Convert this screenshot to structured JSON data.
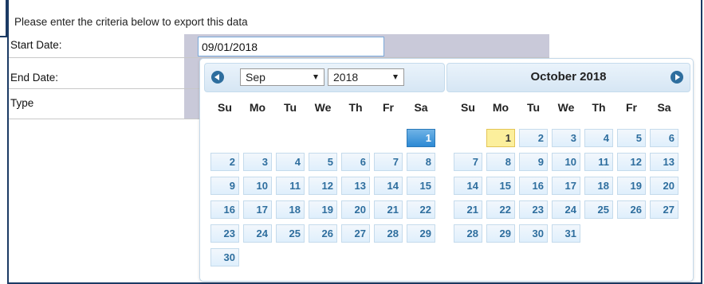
{
  "form": {
    "intro": "Please enter the criteria below to export this data",
    "start_label": "Start Date:",
    "end_label": "End Date:",
    "type_label": "Type",
    "start_value": "09/01/2018"
  },
  "calendar": {
    "weekdays": [
      "Su",
      "Mo",
      "Tu",
      "We",
      "Th",
      "Fr",
      "Sa"
    ],
    "left": {
      "month_select": "Sep",
      "year_select": "2018",
      "first_weekday": 6,
      "days_in_month": 30,
      "selected_day": 1
    },
    "right": {
      "title": "October  2018",
      "first_weekday": 1,
      "days_in_month": 31,
      "today_day": 1
    },
    "icons": {
      "prev": "prev-circle-icon",
      "next": "next-circle-icon"
    },
    "colors": {
      "accent": "#2e6e9e",
      "selected": "#2c89d4",
      "today": "#fcef9c"
    }
  }
}
